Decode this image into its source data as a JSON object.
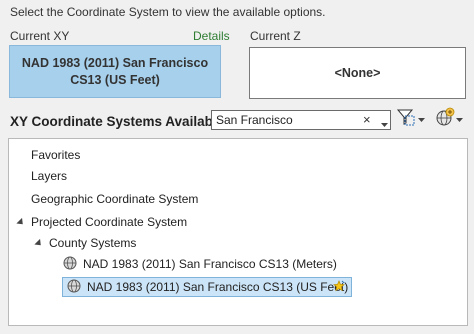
{
  "instruction": "Select the Coordinate System to view the available options.",
  "current_xy": {
    "label": "Current XY",
    "details_link": "Details",
    "value": "NAD 1983 (2011) San Francisco CS13 (US Feet)"
  },
  "current_z": {
    "label": "Current Z",
    "value": "<None>"
  },
  "available": {
    "title": "XY Coordinate Systems Available",
    "search_value": "San Francisco",
    "clear_glyph": "×"
  },
  "tree": {
    "favorites": "Favorites",
    "layers": "Layers",
    "geographic": "Geographic Coordinate System",
    "projected": "Projected Coordinate System",
    "county_systems": "County Systems",
    "item_meters": "NAD 1983 (2011) San Francisco CS13 (Meters)",
    "item_us_feet": "NAD 1983 (2011) San Francisco CS13 (US Feet)"
  },
  "icons": {
    "filter": "filter-icon",
    "globe_add": "globe-add-icon",
    "globe": "globe-icon",
    "star": "favorite-star-icon"
  },
  "colors": {
    "selection_fill": "#cce4f7",
    "current_xy_fill": "#a7d0ec",
    "details_green": "#2e7d32"
  }
}
